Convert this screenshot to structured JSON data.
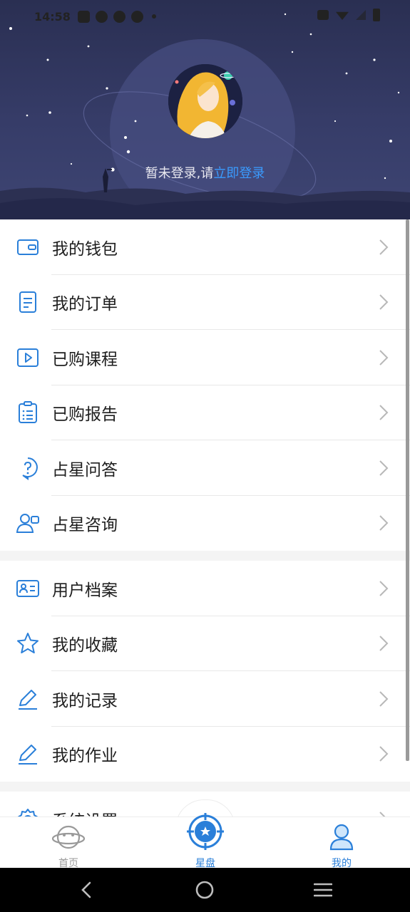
{
  "status_bar": {
    "time": "14:58"
  },
  "header": {
    "login_prompt": "暂未登录,请",
    "login_link": "立即登录"
  },
  "menu_groups": [
    {
      "items": [
        {
          "label": "我的钱包",
          "icon": "wallet-icon"
        },
        {
          "label": "我的订单",
          "icon": "order-icon"
        },
        {
          "label": "已购课程",
          "icon": "course-play-icon"
        },
        {
          "label": "已购报告",
          "icon": "report-clipboard-icon"
        },
        {
          "label": "占星问答",
          "icon": "question-bubble-icon"
        },
        {
          "label": "占星咨询",
          "icon": "consult-person-icon"
        }
      ]
    },
    {
      "items": [
        {
          "label": "用户档案",
          "icon": "profile-card-icon"
        },
        {
          "label": "我的收藏",
          "icon": "star-icon"
        },
        {
          "label": "我的记录",
          "icon": "pencil-icon"
        },
        {
          "label": "我的作业",
          "icon": "pencil-icon"
        }
      ]
    },
    {
      "items": [
        {
          "label": "系统设置",
          "icon": "gear-icon"
        }
      ]
    }
  ],
  "tab_bar": {
    "tabs": [
      {
        "label": "首页",
        "icon": "planet-face-icon",
        "active": false
      },
      {
        "label": "星盘",
        "icon": "astrolabe-icon",
        "active": true
      },
      {
        "label": "我的",
        "icon": "user-icon",
        "active": true
      }
    ]
  },
  "colors": {
    "accent": "#2a7fd9",
    "link": "#3a9bff",
    "header_bg": "#323861"
  }
}
